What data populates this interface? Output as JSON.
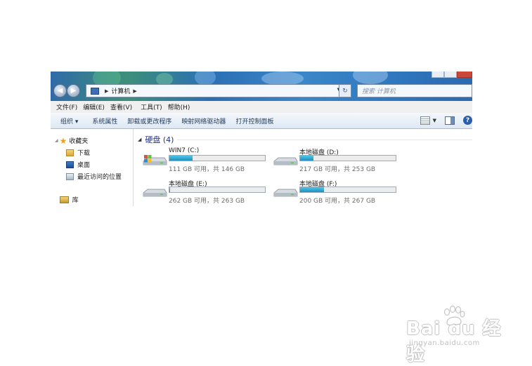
{
  "window": {
    "address": {
      "crumb": "计算机"
    },
    "search_placeholder": "搜索 计算机"
  },
  "menubar": [
    "文件(F)",
    "编辑(E)",
    "查看(V)",
    "工具(T)",
    "帮助(H)"
  ],
  "toolbar": {
    "organize": "组织 ▾",
    "commands": [
      "系统属性",
      "卸载或更改程序",
      "映射网络驱动器",
      "打开控制面板"
    ]
  },
  "sidebar": {
    "favorites": "收藏夹",
    "fav_items": [
      "下载",
      "桌面",
      "最近访问的位置"
    ],
    "library": "库"
  },
  "content": {
    "group_title": "硬盘 (4)",
    "drives": [
      {
        "name": "WIN7 (C:)",
        "size": "111 GB 可用，共 146 GB",
        "used_fraction": 0.24,
        "icon": "windows-drive-icon"
      },
      {
        "name": "本地磁盘 (D:)",
        "size": "217 GB 可用，共 253 GB",
        "used_fraction": 0.14,
        "icon": "hard-drive-icon"
      },
      {
        "name": "本地磁盘 (E:)",
        "size": "262 GB 可用，共 263 GB",
        "used_fraction": 0.01,
        "icon": "hard-drive-icon"
      },
      {
        "name": "本地磁盘 (F:)",
        "size": "200 GB 可用，共 267 GB",
        "used_fraction": 0.25,
        "icon": "hard-drive-icon"
      }
    ]
  },
  "watermark": {
    "brand": "Bai du 经验",
    "url": "jingyan.baidu.com"
  },
  "colors": {
    "usage_bar": "#1f8fc0",
    "link_blue": "#1e3287",
    "titlebar": "#2f78c0"
  }
}
